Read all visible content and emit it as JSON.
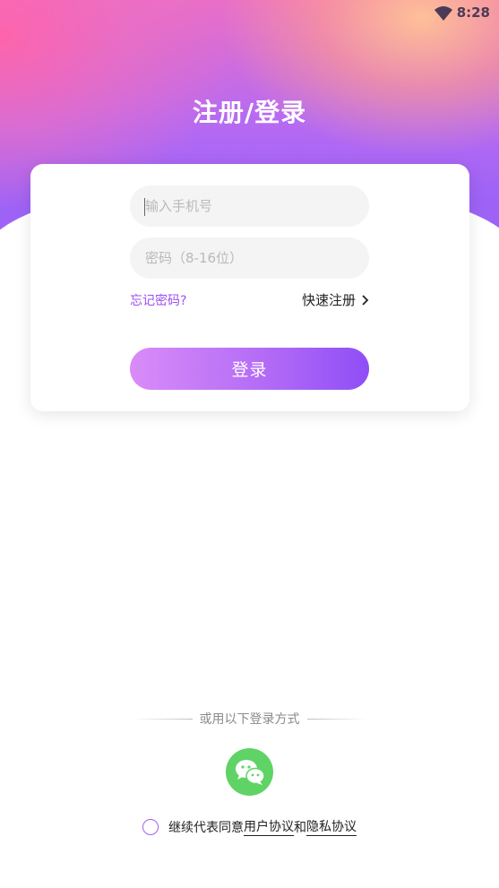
{
  "status_bar": {
    "time": "8:28",
    "wifi_icon": "wifi-icon"
  },
  "page": {
    "title": "注册/登录"
  },
  "form": {
    "phone_placeholder": "输入手机号",
    "phone_value": "",
    "password_placeholder": "密码（8-16位）",
    "password_value": "",
    "forgot_password": "忘记密码?",
    "quick_register": "快速注册",
    "login_button": "登录"
  },
  "other_login": {
    "label": "或用以下登录方式",
    "wechat_icon": "wechat-icon"
  },
  "agreement": {
    "prefix": "继续代表同意",
    "user_agreement": "用户协议",
    "conjunction": "和",
    "privacy_agreement": "隐私协议",
    "checked": false
  },
  "colors": {
    "accent": "#9b4ff0",
    "button_start": "#d98cf7",
    "button_end": "#8f4ef6",
    "wechat_green": "#5fd366"
  }
}
